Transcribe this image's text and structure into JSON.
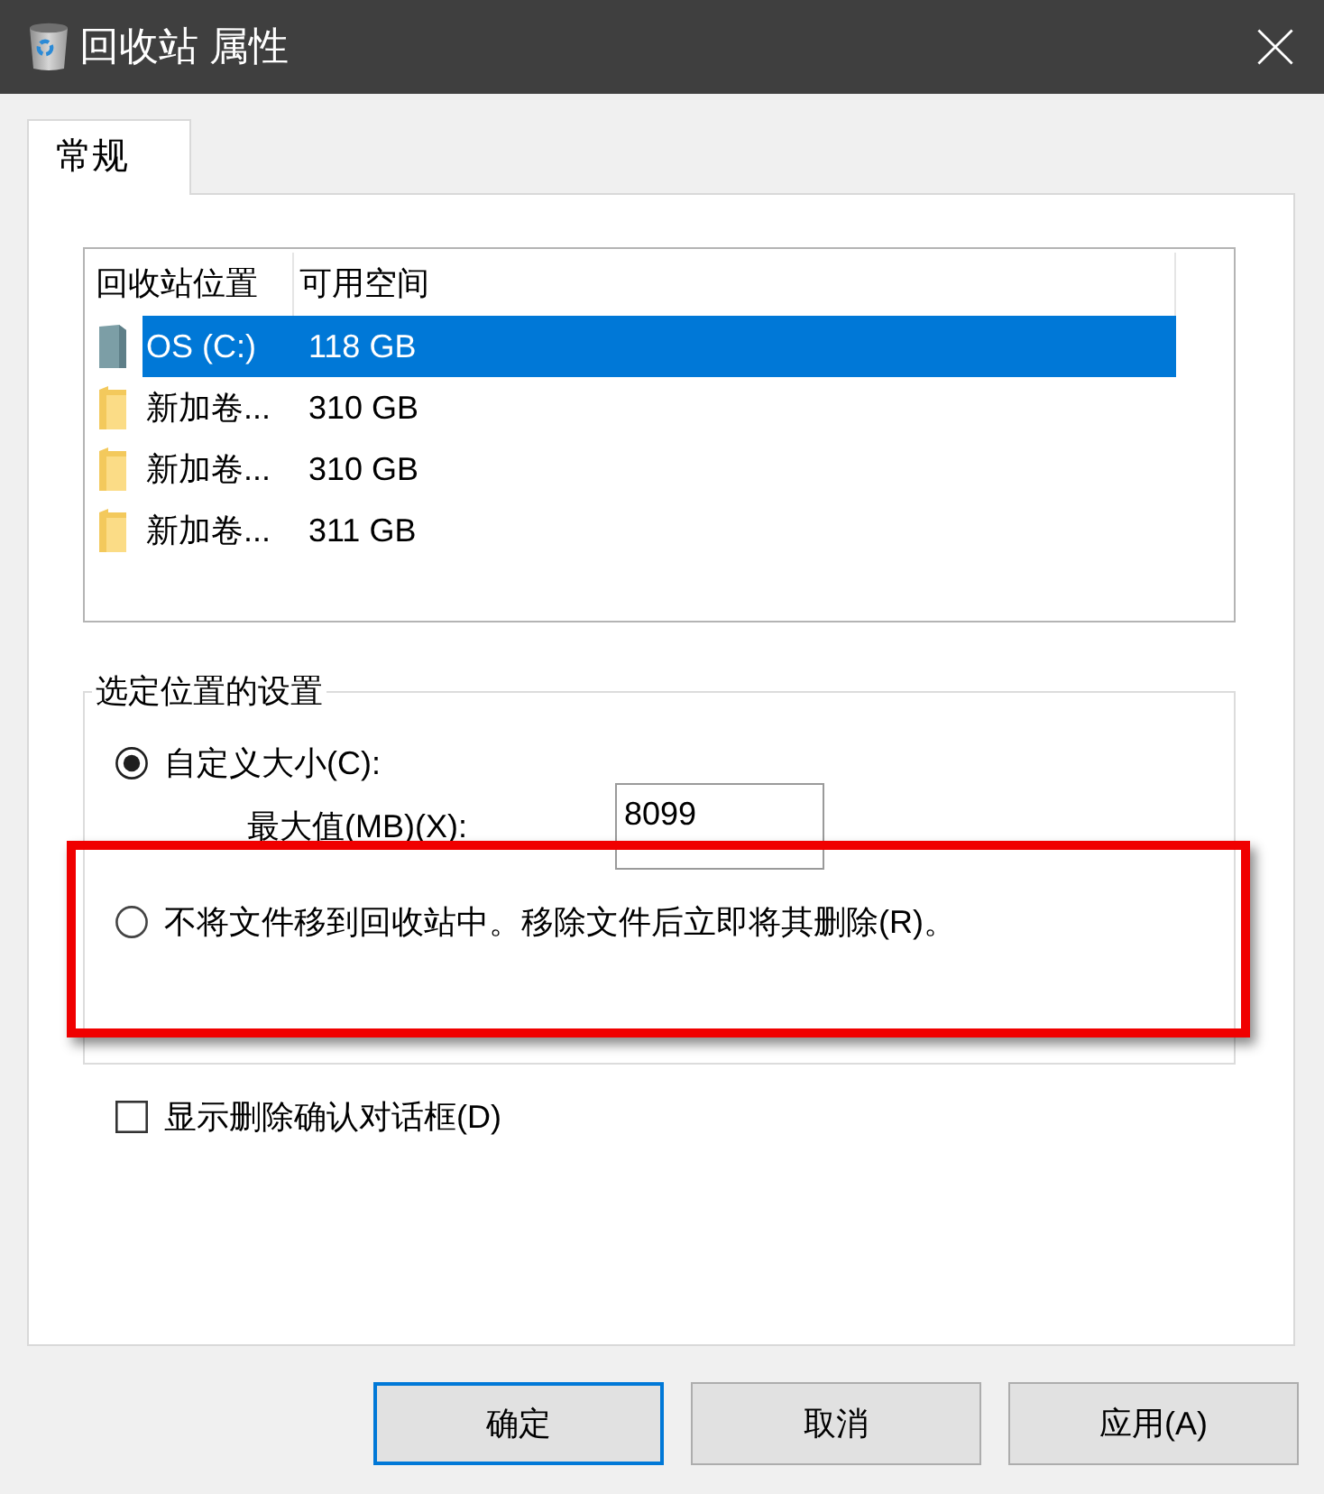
{
  "window": {
    "title": "回收站 属性"
  },
  "tabs": [
    {
      "label": "常规",
      "selected": true
    }
  ],
  "locations": {
    "columns": [
      "回收站位置",
      "可用空间"
    ],
    "rows": [
      {
        "kind": "drive",
        "name": "OS (C:)",
        "free_space": "118 GB",
        "selected": true
      },
      {
        "kind": "folder",
        "name": "新加卷...",
        "free_space": "310 GB",
        "selected": false
      },
      {
        "kind": "folder",
        "name": "新加卷...",
        "free_space": "310 GB",
        "selected": false
      },
      {
        "kind": "folder",
        "name": "新加卷...",
        "free_space": "311 GB",
        "selected": false
      }
    ]
  },
  "settings": {
    "title": "选定位置的设置",
    "options": [
      {
        "label": "自定义大小(C):",
        "selected": true,
        "highlighted": false
      },
      {
        "label": "不将文件移到回收站中。移除文件后立即将其删除(R)。",
        "selected": false,
        "highlighted": true
      }
    ],
    "max_size": {
      "label": "最大值(MB)(X):",
      "value": "8099"
    }
  },
  "confirm_delete": {
    "label": "显示删除确认对话框(D)",
    "checked": false
  },
  "buttons": [
    {
      "label": "确定",
      "default": true
    },
    {
      "label": "取消",
      "default": false
    },
    {
      "label": "应用(A)",
      "default": false
    }
  ]
}
